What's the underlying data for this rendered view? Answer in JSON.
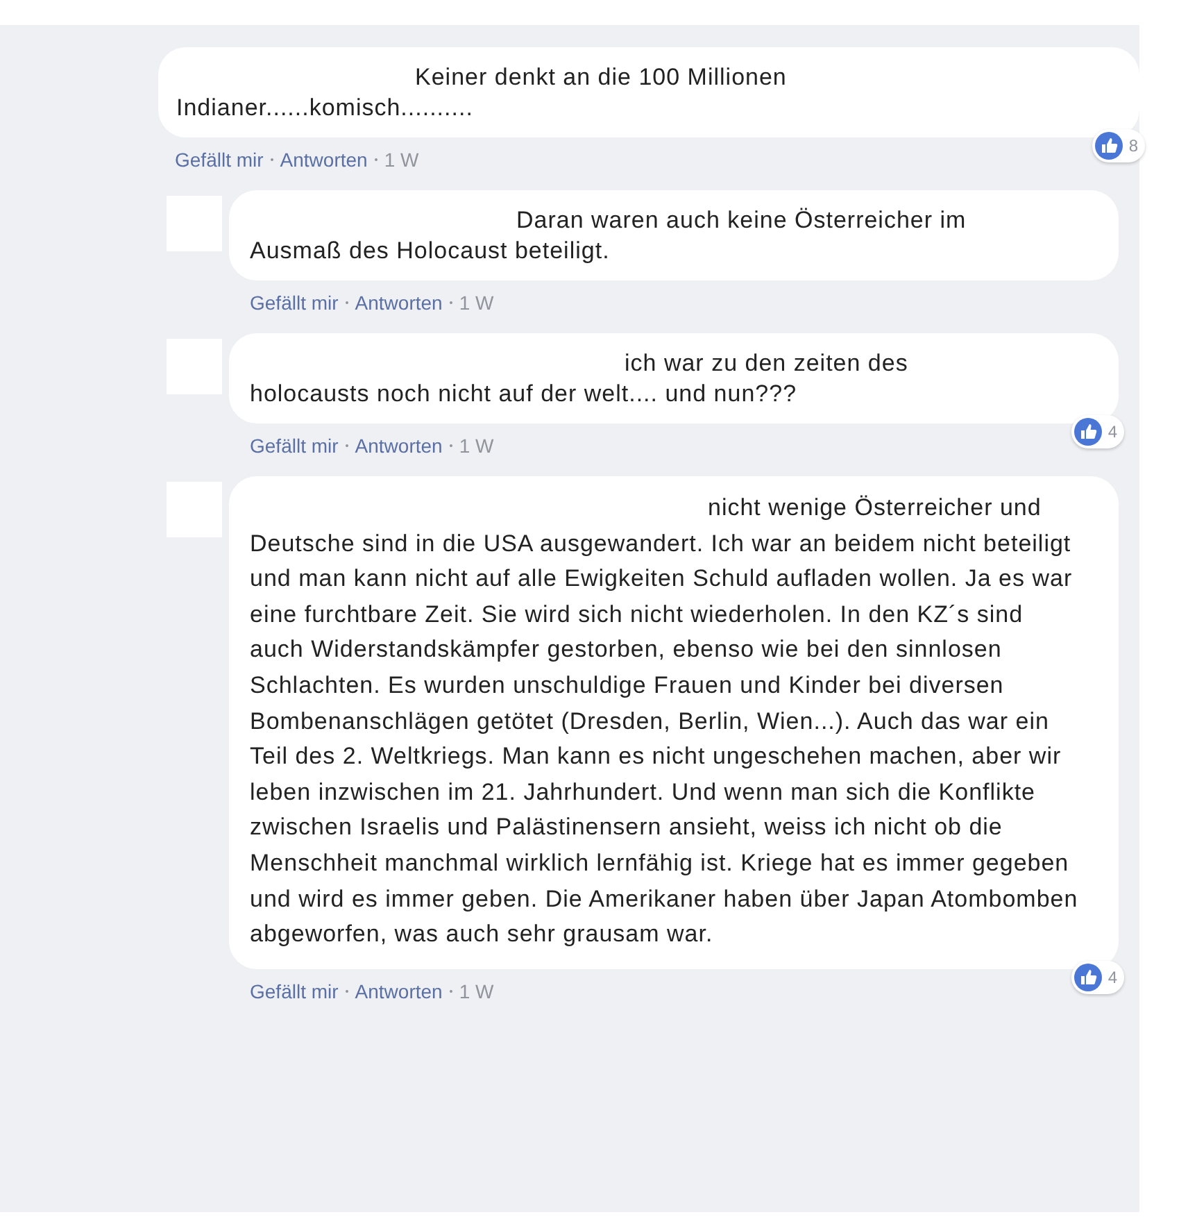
{
  "comments": [
    {
      "reply": false,
      "text": "Keiner denkt an die 100 Millionen Indianer......komisch..........",
      "actions": [
        {
          "kind": "link",
          "label": "Gefällt mir"
        },
        {
          "kind": "link",
          "label": "Antworten"
        },
        {
          "kind": "time",
          "label": "1 W"
        }
      ],
      "reactions": "8"
    },
    {
      "reply": true,
      "text": "Daran waren auch keine Österreicher im Ausmaß des Holocaust beteiligt.",
      "actions": [
        {
          "kind": "link",
          "label": "Gefällt mir"
        },
        {
          "kind": "link",
          "label": "Antworten"
        },
        {
          "kind": "time",
          "label": "1 W"
        }
      ]
    },
    {
      "reply": true,
      "text": "ich war zu den zeiten des holocausts noch nicht auf der welt.... und nun???",
      "actions": [
        {
          "kind": "link",
          "label": "Gefällt mir"
        },
        {
          "kind": "link",
          "label": "Antworten"
        },
        {
          "kind": "time",
          "label": "1 W"
        }
      ],
      "reactions": "4"
    },
    {
      "reply": true,
      "text": "nicht wenige Österreicher und Deutsche sind in die USA ausgewandert. Ich war an beidem nicht beteiligt und man kann nicht auf alle Ewigkeiten Schuld aufladen wollen. Ja es war eine furchtbare Zeit. Sie wird sich nicht wiederholen. In den KZ´s sind auch Widerstandskämpfer gestorben, ebenso wie bei den sinnlosen Schlachten. Es wurden unschuldige Frauen und Kinder bei diversen Bombenanschlägen getötet (Dresden, Berlin, Wien...). Auch das war ein Teil des 2. Weltkriegs. Man kann es nicht ungeschehen machen, aber wir leben inzwischen im 21. Jahrhundert. Und wenn man sich die Konflikte zwischen Israelis und Palästinensern ansieht, weiss ich nicht ob die Menschheit manchmal wirklich lernfähig ist. Kriege hat es immer gegeben und wird es immer geben. Die Amerikaner haben über Japan Atombomben abgeworfen, was auch sehr grausam war.",
      "actions": [
        {
          "kind": "link",
          "label": "Gefällt mir"
        },
        {
          "kind": "link",
          "label": "Antworten"
        },
        {
          "kind": "time",
          "label": "1 W"
        }
      ],
      "reactions": "4"
    }
  ]
}
